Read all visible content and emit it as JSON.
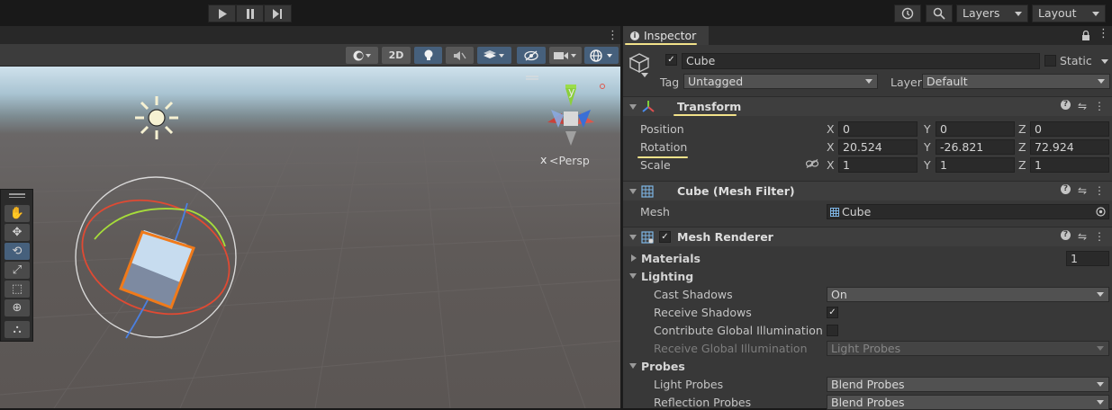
{
  "toolbar": {
    "play_icon": "play-icon",
    "pause_icon": "pause-icon",
    "step_icon": "step-icon",
    "layers_label": "Layers",
    "layout_label": "Layout"
  },
  "scene": {
    "mode_2d": "2D",
    "persp_label": "Persp",
    "gizmo_x": "x",
    "gizmo_y": "y"
  },
  "inspector": {
    "tab_label": "Inspector",
    "object": {
      "name": "Cube",
      "active": true,
      "static_label": "Static",
      "tag_label": "Tag",
      "tag_value": "Untagged",
      "layer_label": "Layer",
      "layer_value": "Default"
    },
    "transform": {
      "title": "Transform",
      "position": {
        "label": "Position",
        "x": "0",
        "y": "0",
        "z": "0"
      },
      "rotation": {
        "label": "Rotation",
        "x": "20.524",
        "y": "-26.821",
        "z": "72.924"
      },
      "scale": {
        "label": "Scale",
        "x": "1",
        "y": "1",
        "z": "1"
      },
      "axis_x": "X",
      "axis_y": "Y",
      "axis_z": "Z"
    },
    "mesh_filter": {
      "title": "Cube (Mesh Filter)",
      "mesh_label": "Mesh",
      "mesh_value": "Cube"
    },
    "mesh_renderer": {
      "title": "Mesh Renderer",
      "enabled": true,
      "materials_label": "Materials",
      "materials_count": "1",
      "lighting_label": "Lighting",
      "cast_shadows_label": "Cast Shadows",
      "cast_shadows_value": "On",
      "receive_shadows_label": "Receive Shadows",
      "receive_shadows": true,
      "contribute_gi_label": "Contribute Global Illumination",
      "contribute_gi": false,
      "receive_gi_label": "Receive Global Illumination",
      "receive_gi_value": "Light Probes",
      "probes_label": "Probes",
      "light_probes_label": "Light Probes",
      "light_probes_value": "Blend Probes",
      "reflection_probes_label": "Reflection Probes",
      "reflection_probes_value": "Blend Probes"
    }
  },
  "colors": {
    "annotation_underline": "#f2e28a",
    "selection_outline": "#f07a1a",
    "active_button": "#46607c"
  }
}
